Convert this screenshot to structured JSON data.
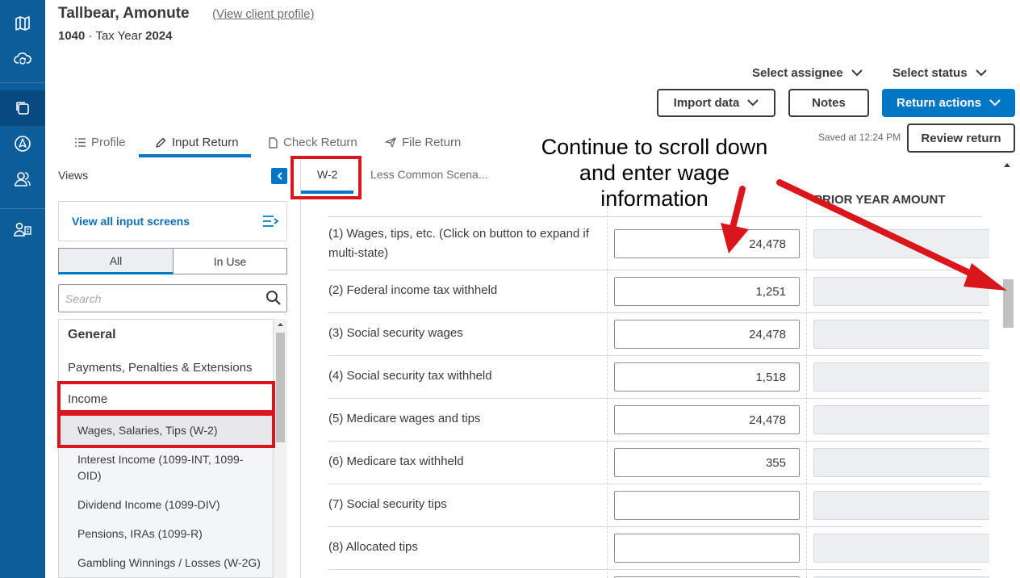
{
  "header": {
    "client_name": "Tallbear, Amonute",
    "client_link": "(View client profile)",
    "form": "1040",
    "tax_year_label": "Tax Year",
    "tax_year": "2024"
  },
  "toolbar": {
    "select_assignee": "Select assignee",
    "select_status": "Select status",
    "import_data": "Import data",
    "notes": "Notes",
    "return_actions": "Return actions",
    "review_return": "Review return",
    "saved": "Saved at 12:24 PM"
  },
  "tabs": [
    {
      "label": "Profile",
      "icon": "list-icon"
    },
    {
      "label": "Input Return",
      "icon": "pencil-icon",
      "active": true
    },
    {
      "label": "Check Return",
      "icon": "document-icon"
    },
    {
      "label": "File Return",
      "icon": "send-icon"
    }
  ],
  "left_panel": {
    "views_label": "Views",
    "view_all": "View all input screens",
    "segments": [
      "All",
      "In Use"
    ],
    "search_placeholder": "Search",
    "nav": {
      "general": "General",
      "payments": "Payments, Penalties & Extensions",
      "income": "Income",
      "sub_items": [
        "Wages, Salaries, Tips (W-2)",
        "Interest Income (1099-INT, 1099-OID)",
        "Dividend Income (1099-DIV)",
        "Pensions, IRAs (1099-R)",
        "Gambling Winnings / Losses (W-2G)"
      ]
    }
  },
  "form": {
    "sub_tabs": [
      "W-2",
      "Less Common Scena..."
    ],
    "prior_year_header": "PRIOR YEAR AMOUNT",
    "rows": [
      {
        "label": "(1) Wages, tips, etc. (Click on button to expand if multi-state)",
        "value": "24,478"
      },
      {
        "label": "(2) Federal income tax withheld",
        "value": "1,251"
      },
      {
        "label": "(3) Social security wages",
        "value": "24,478"
      },
      {
        "label": "(4) Social security tax withheld",
        "value": "1,518"
      },
      {
        "label": "(5) Medicare wages and tips",
        "value": "24,478"
      },
      {
        "label": "(6) Medicare tax withheld",
        "value": "355"
      },
      {
        "label": "(7) Social security tips",
        "value": ""
      },
      {
        "label": "(8) Allocated tips",
        "value": ""
      }
    ]
  },
  "annotation": {
    "text": "Continue to scroll down and enter wage information",
    "color": "#d9161c"
  },
  "colors": {
    "rail": "#0d5d9b",
    "primary": "#0077c5",
    "annotation_red": "#d9161c"
  }
}
